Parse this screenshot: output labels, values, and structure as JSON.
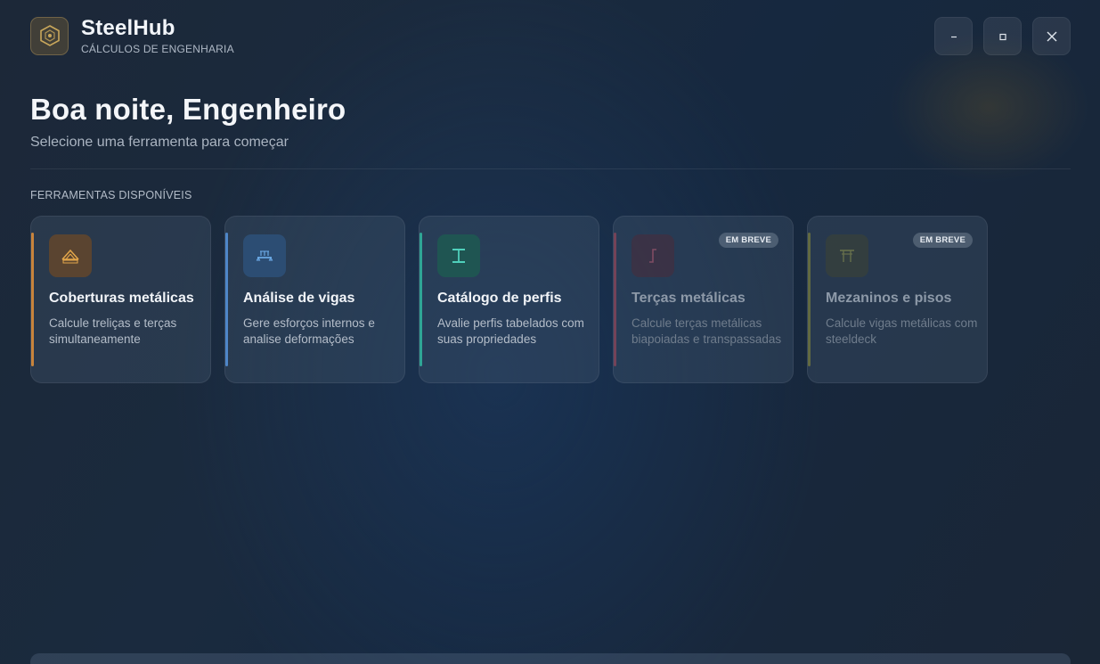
{
  "app": {
    "name": "SteelHub",
    "subtitle": "CÁLCULOS DE ENGENHARIA",
    "logo_icon": "hexagon-steel-icon",
    "accent_color": "#c9a75b"
  },
  "window_controls": [
    {
      "icon": "minimize-icon",
      "label": "–"
    },
    {
      "icon": "maximize-icon",
      "label": "□"
    },
    {
      "icon": "close-icon",
      "label": "✕"
    }
  ],
  "hero": {
    "greeting": "Boa noite, Engenheiro",
    "lead": "Selecione uma ferramenta para começar"
  },
  "section": {
    "title": "FERRAMENTAS DISPONÍVEIS"
  },
  "cards": [
    {
      "title": "Coberturas metálicas",
      "description": "Calcule treliças e terças simultaneamente",
      "icon": "roof-truss-icon",
      "accent": "#c8843c",
      "icon_bg": "#5a4430",
      "icon_color": "#e3a64a",
      "badge": "",
      "enabled": true
    },
    {
      "title": "Análise de vigas",
      "description": "Gere esforços internos e analise deformações",
      "icon": "beam-load-icon",
      "accent": "#4e86c8",
      "icon_bg": "#2c4d73",
      "icon_color": "#6fb0ee",
      "badge": "",
      "enabled": true
    },
    {
      "title": "Catálogo de perfis",
      "description": "Avalie perfis tabelados com suas propriedades",
      "icon": "i-beam-profile-icon",
      "accent": "#2fa595",
      "icon_bg": "#1f5552",
      "icon_color": "#4fd0bb",
      "badge": "",
      "enabled": true
    },
    {
      "title": "Terças metálicas",
      "description": "Calcule terças metálicas biapoiadas e transpassadas",
      "icon": "purlin-icon",
      "accent": "#a8485a",
      "icon_bg": "#4a2c3a",
      "icon_color": "#c85a70",
      "badge": "EM BREVE",
      "enabled": false
    },
    {
      "title": "Mezaninos e pisos",
      "description": "Calcule vigas metálicas com steeldeck",
      "icon": "mezzanine-icon",
      "accent": "#8a8c3a",
      "icon_bg": "#3e4433",
      "icon_color": "#9a9c4a",
      "badge": "EM BREVE",
      "enabled": false
    }
  ]
}
